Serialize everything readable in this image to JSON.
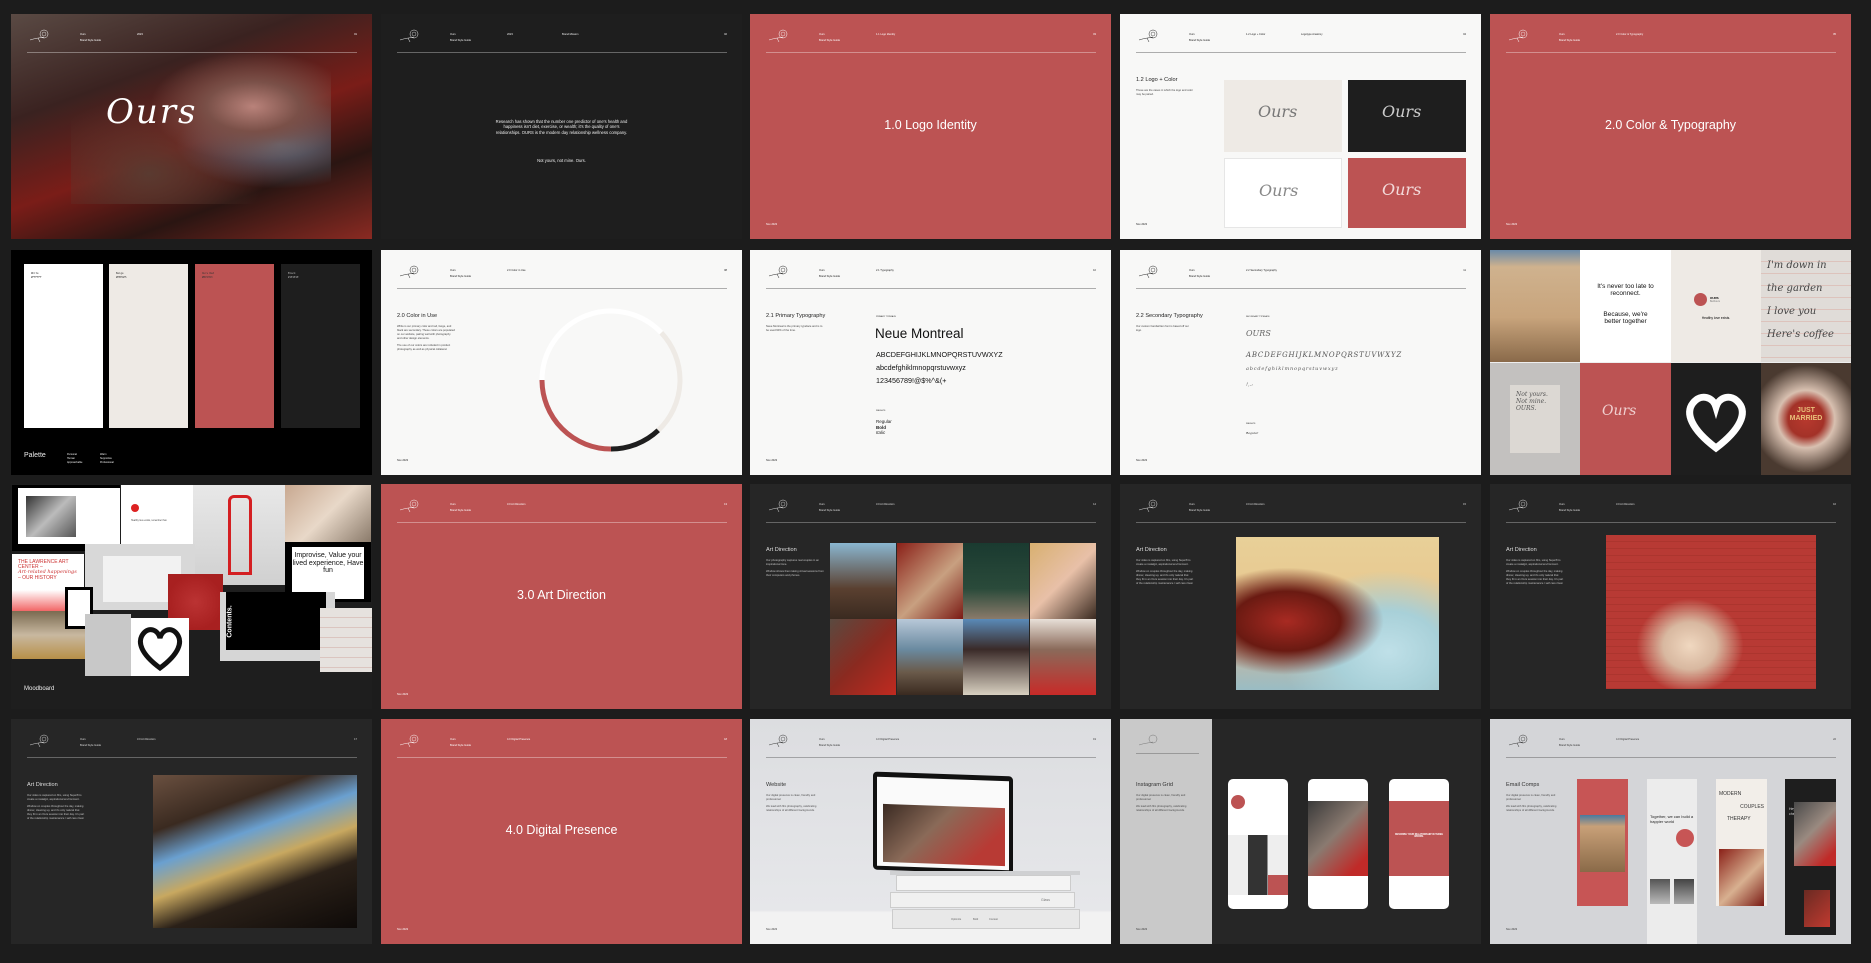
{
  "common": {
    "brand": "Ours",
    "subtitle": "Brand Style Guide",
    "footer": "Nov 2023"
  },
  "colors": {
    "background": "#1c1c1c",
    "ours_red": "#bc5353",
    "beige": "#eeeae5",
    "black": "#1e1e1e",
    "white": "#ffffff"
  },
  "slides": [
    {
      "header": {
        "section": "2023",
        "section2": "",
        "num": "01"
      },
      "logo_text": "Ours"
    },
    {
      "header": {
        "section": "2023",
        "section2": "Brand Mission",
        "num": "02"
      },
      "body": "Research has shown that the number one predictor of one's health and happiness isn't diet, exercise, or wealth; it's the quality of one's relationships. OURS is the modern day relationship wellness company.",
      "tagline": "Not yours, not mine. Ours."
    },
    {
      "header": {
        "section": "1.1 Logo Identity",
        "section2": "",
        "num": "03"
      },
      "title": "1.0 Logo Identity"
    },
    {
      "header": {
        "section": "1.2 Logo + Color",
        "section2": "Logotype Anatomy",
        "num": "04"
      },
      "title": "1.2 Logo + Color",
      "desc": "These are the cases in which the logo and color may be paired.",
      "logo_text": "Ours"
    },
    {
      "header": {
        "section": "2.0 Color & Typography",
        "section2": "",
        "num": "05"
      },
      "title": "2.0 Color & Typography"
    },
    {
      "title": "Palette",
      "swatches": [
        {
          "name": "White",
          "hex": "#FFFFFF"
        },
        {
          "name": "Beige",
          "hex": "#EEEAE5"
        },
        {
          "name": "Ours Red",
          "hex": "#BC5353"
        },
        {
          "name": "Black",
          "hex": "#1E1E1E"
        }
      ],
      "col1": [
        "Personal",
        "Human",
        "Approachable"
      ],
      "col2": [
        "Warm",
        "Supportive",
        "Professional"
      ]
    },
    {
      "header": {
        "section": "2.0 Color in Use",
        "section2": "",
        "num": "08"
      },
      "title": "2.0 Color in Use",
      "p1": "While is our primary color and red, beige, and black are secondary. These colors are populated on our website, pairing well with photography and other design elements.",
      "p2": "The use of our colors are included in product photography as well as physical collateral.",
      "color_ring": [
        {
          "color": "#ffffff",
          "share": 0.38
        },
        {
          "color": "#eeeae5",
          "share": 0.25
        },
        {
          "color": "#1e1e1e",
          "share": 0.12
        },
        {
          "color": "#bc5353",
          "share": 0.25
        }
      ]
    },
    {
      "header": {
        "section": "2.1 Typography",
        "section2": "",
        "num": "10"
      },
      "title": "2.1 Primary Typography",
      "desc": "Neue Montreal is the primary typeface and is to be used 90% of the time.",
      "label": "PRIMARY TYPEFACE",
      "font": "Neue Montreal",
      "upper": "ABCDEFGHIJKLMNOPQRSTUVWXYZ",
      "lower": "abcdefghiklmnopqrstuvwxyz",
      "nums": "123456789!@$%^&(+",
      "weights_label": "WEIGHTS",
      "weights": [
        "Regular",
        "Bold",
        "Italic"
      ]
    },
    {
      "header": {
        "section": "2.2 Secondary Typography",
        "section2": "",
        "num": "11"
      },
      "title": "2.2 Secondary Typography",
      "desc": "Our custom handwritten font is based off our logo.",
      "label": "SECONDARY TYPEFACE",
      "sample": "OURS",
      "upper": "ABCDEFGHIJKLMNOPQRSTUVWXYZ",
      "lower": "abcdefghiklmnopqrstuvwxyz",
      "symbols": "!,.:",
      "weights_label": "WEIGHTS",
      "weight": "Regular"
    },
    {
      "quote1": "It's never too late to reconnect.",
      "quote2": "Because, we're better together",
      "brand": "OURS",
      "brand_sub": "Bethours",
      "healthy": "Healthy love exists.",
      "note": [
        "I'm down in",
        "the garden",
        "I love you",
        "Here's coffee"
      ],
      "print": "Not yours. Not mine. OURS.",
      "logo_text": "Ours",
      "pizza": "JUST MARRIED"
    },
    {
      "title": "Moodboard",
      "improvise": "Improvise, Value your lived experience, Have fun",
      "lawrence": "THE LAWRENCE ART CENTER –",
      "lawrence2": "Art-related happenings",
      "lawrence3": "– OUR HISTORY",
      "contents": "Contents.",
      "healthy": "Healthy love exists, remember that."
    },
    {
      "header": {
        "section": "3.0 Art Direction",
        "section2": "",
        "num": "13"
      },
      "title": "3.0 Art Direction"
    },
    {
      "header": {
        "section": "3.0 Art Direction",
        "section2": "",
        "num": "14"
      },
      "title": "Art Direction",
      "p1": "Our photography captures real couples in an inspirational tone.",
      "p2": "Window shows them taking virtual sessions from their computers and phones."
    },
    {
      "header": {
        "section": "3.0 Art Direction",
        "section2": "",
        "num": "15"
      },
      "title": "Art Direction",
      "p1": "Our video is captured on film, using Super8 to create a nostalgic, aspirational environment.",
      "p2": "Window on couples throughout the day, making dinner, cleaning up, and it's only natural that they fit in an Ours session into their day. It's part of the relationship maintenance / self care ritual."
    },
    {
      "header": {
        "section": "3.0 Art Direction",
        "section2": "",
        "num": "16"
      },
      "title": "Art Direction",
      "p1": "Our video is captured on film, using Super8 to create a nostalgic, aspirational environment.",
      "p2": "Window on couples throughout the day, making dinner, cleaning up, and it's only natural that they fit in an Ours session into their day. It's part of the relationship maintenance / self care ritual."
    },
    {
      "header": {
        "section": "3.0 Art Direction",
        "section2": "",
        "num": "17"
      },
      "title": "Art Direction",
      "p1": "Our video is captured on film, using Super8 to create a nostalgic, aspirational environment.",
      "p2": "Window on couples throughout the day, making dinner, cleaning up, and it's only natural that they fit in an Ours session into their day. It's part of the relationship maintenance / self care ritual."
    },
    {
      "header": {
        "section": "4.0 Digital Presence",
        "section2": "",
        "num": "18"
      },
      "title": "4.0 Digital Presence"
    },
    {
      "header": {
        "section": "4.0 Digital Presence",
        "section2": "",
        "num": "19"
      },
      "title": "Website",
      "p1": "Our digital presence is clean, friendly and professional.",
      "p2": "We lead with film photography, celebrating relationships of all different backgrounds.",
      "book_labels": [
        "Optimize",
        "Bold",
        "Contest"
      ],
      "book2": "Glass"
    },
    {
      "title": "Instagram Grid",
      "p1": "Our digital presence is clean, friendly and professional.",
      "p2": "We lead with film photography, celebrating relationships of all different backgrounds.",
      "post_text": "DESCRIBE YOUR RELATIONSHIP IN THREE WORDS."
    },
    {
      "header": {
        "section": "4.0 Digital Presence",
        "section2": "",
        "num": "22"
      },
      "title": "Email Comps",
      "p1": "Our digital presence is clean, friendly and professional.",
      "p2": "We lead with film photography, celebrating relationships of all different backgrounds.",
      "email2": "Together, we can build a happier world",
      "email3": [
        "MODERN",
        "COUPLES",
        "THERAPY"
      ],
      "email4": "Hey there, checking in"
    }
  ]
}
